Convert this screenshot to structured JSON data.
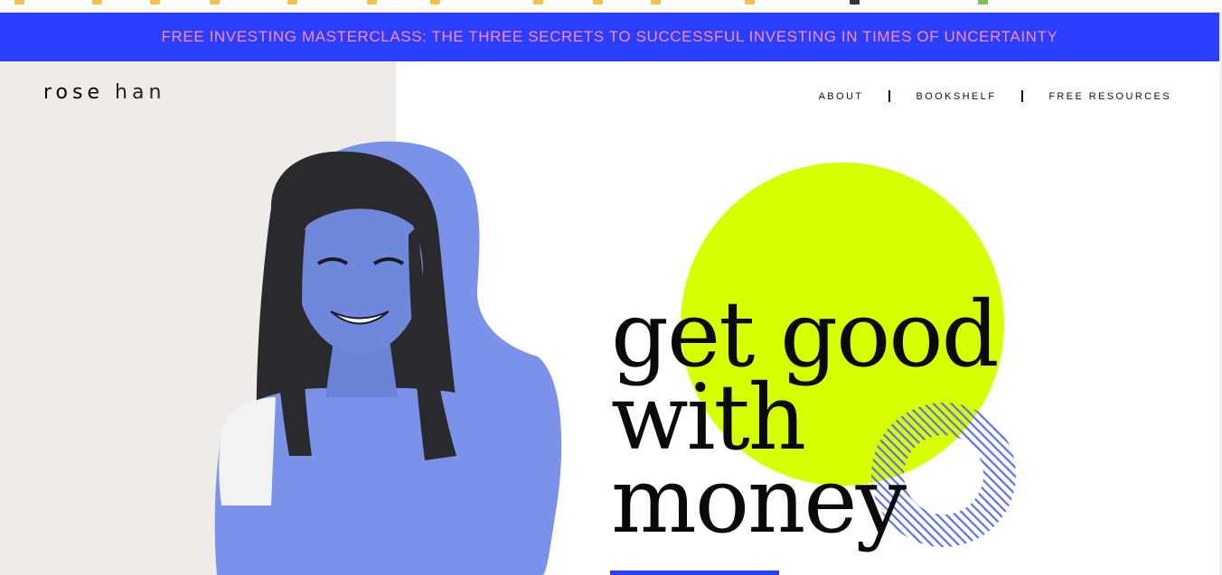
{
  "banner": {
    "text": "FREE INVESTING MASTERCLASS: THE THREE SECRETS TO SUCCESSFUL INVESTING IN TIMES OF UNCERTAINTY",
    "background": "#2b3dff",
    "text_color": "#ff8ab4"
  },
  "logo": {
    "first": "rose",
    "second": "han"
  },
  "nav": {
    "items": [
      {
        "label": "ABOUT"
      },
      {
        "label": "BOOKSHELF"
      },
      {
        "label": "FREE RESOURCES"
      }
    ]
  },
  "hero": {
    "headline_line1": "get good",
    "headline_line2": "with",
    "headline_line3": "money",
    "accent_circle_color": "#d8ff00",
    "shape_color": "#7a93e8",
    "stripe_ring_color": "#5c6ff0"
  },
  "icons": {
    "bookmark": "folder-icon",
    "portrait": "person-photo"
  }
}
